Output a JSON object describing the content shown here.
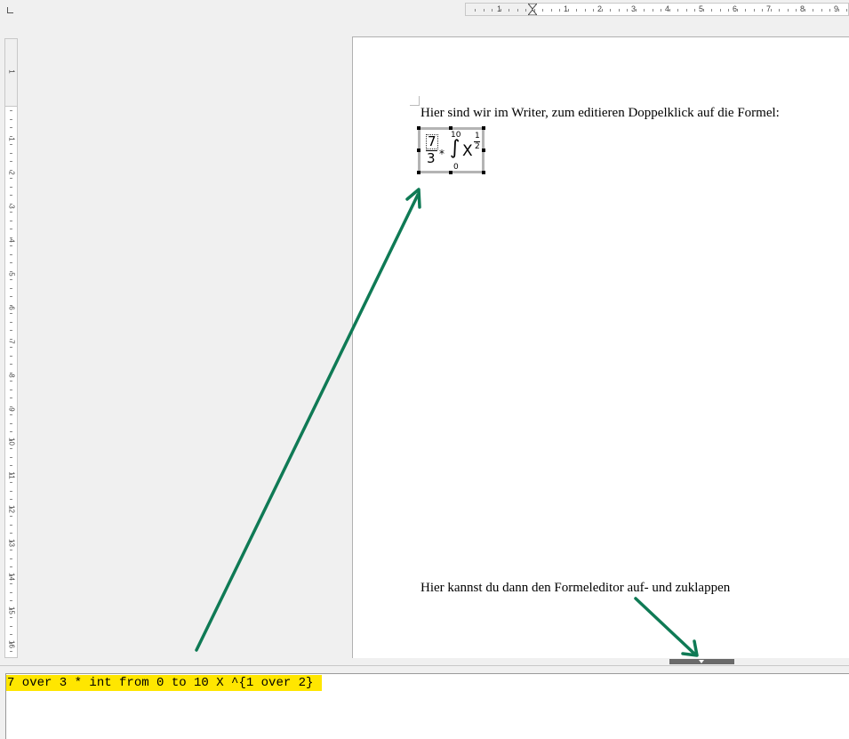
{
  "ruler": {
    "horizontal_numbers": [
      "1",
      "1",
      "2",
      "3",
      "4",
      "5",
      "6",
      "7",
      "8",
      "9"
    ],
    "vertical_numbers": [
      "1",
      "1",
      "2",
      "3",
      "4",
      "5",
      "6",
      "7",
      "8",
      "9",
      "10",
      "11",
      "12",
      "13",
      "14",
      "15",
      "16"
    ]
  },
  "document": {
    "line1": "Hier sind wir im Writer, zum editieren Doppelklick auf die Formel:",
    "line2": "Hier kannst du dann den Formeleditor auf- und zuklappen"
  },
  "formula": {
    "numerator": "7",
    "denominator": "3",
    "operator": "*",
    "integral_symbol": "∫",
    "upper_limit": "10",
    "lower_limit": "0",
    "variable": "X",
    "exponent_numerator": "1",
    "exponent_denominator": "2"
  },
  "editor": {
    "code": "7 over 3 * int from 0 to 10 X ^{1 over 2}"
  },
  "colors": {
    "arrow": "#0f7a55",
    "highlight": "#ffe600",
    "frame": "#b4b4b4"
  }
}
